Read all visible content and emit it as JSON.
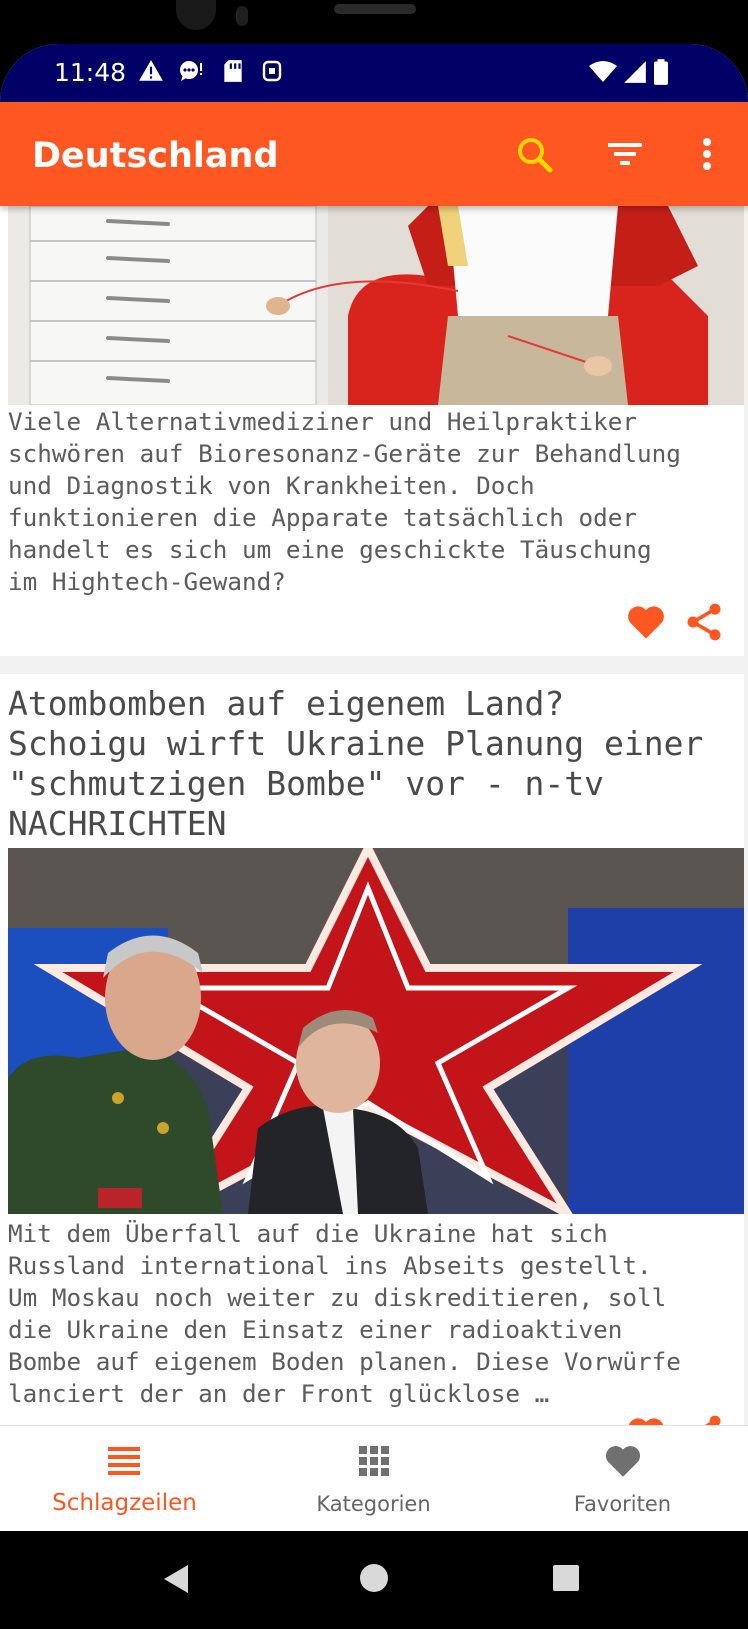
{
  "status": {
    "time": "11:48"
  },
  "appbar": {
    "title": "Deutschland"
  },
  "colors": {
    "accent": "#ff5722",
    "status_bar": "#000066",
    "search_icon": "#ffd600"
  },
  "icons": {
    "status": [
      "warning-icon",
      "chat-icon",
      "sd-card-icon",
      "sim-icon",
      "wifi-icon",
      "signal-icon",
      "battery-icon"
    ],
    "appbar": [
      "search-icon",
      "filter-icon",
      "more-vert-icon"
    ],
    "card": [
      "heart-icon",
      "share-icon"
    ],
    "nav": [
      "list-icon",
      "grid-icon",
      "heart-icon"
    ],
    "system": [
      "back-icon",
      "home-icon",
      "recents-icon"
    ]
  },
  "articles": [
    {
      "description": "Viele Alternativmediziner und Heilpraktiker\nschwören auf Bioresonanz-Geräte zur Behandlung\nund Diagnostik von Krankheiten. Doch\nfunktionieren die Apparate tatsächlich oder\nhandelt es sich um eine geschickte Täuschung\nim Hightech-Gewand?"
    },
    {
      "title": "Atombomben auf eigenem Land?\nSchoigu wirft Ukraine Planung einer\n\"schmutzigen Bombe\" vor - n-tv\nNACHRICHTEN",
      "description": "Mit dem Überfall auf die Ukraine hat sich\nRussland international ins Abseits gestellt.\nUm Moskau noch weiter zu diskreditieren, soll\ndie Ukraine den Einsatz einer radioaktiven\nBombe auf eigenem Boden planen. Diese Vorwürfe\nlanciert der an der Front glücklose …"
    }
  ],
  "bottom_nav": [
    {
      "label": "Schlagzeilen",
      "active": true
    },
    {
      "label": "Kategorien",
      "active": false
    },
    {
      "label": "Favoriten",
      "active": false
    }
  ]
}
